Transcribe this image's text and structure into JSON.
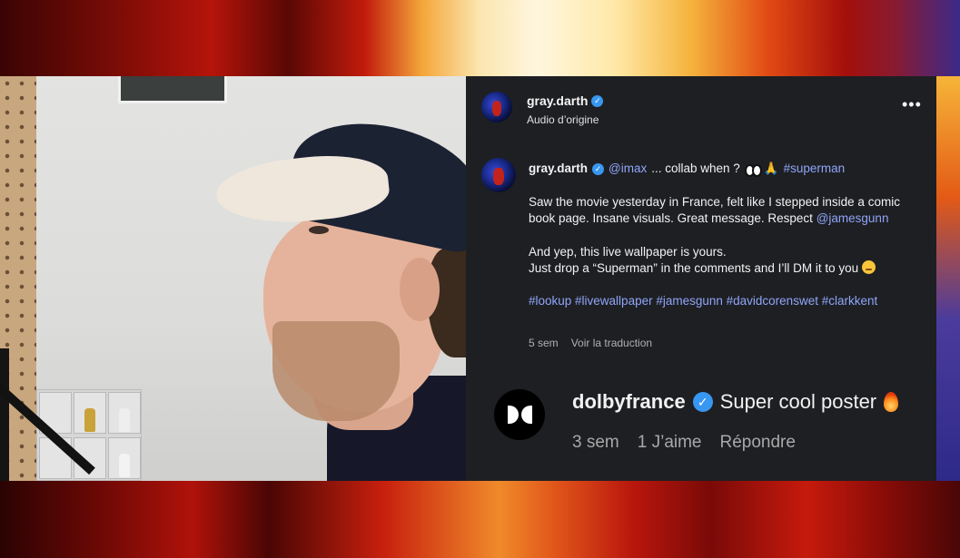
{
  "post": {
    "author": "gray.darth",
    "audio": "Audio d’origine",
    "more_label": "•••"
  },
  "caption": {
    "author": "gray.darth",
    "mention_imax": "@imax",
    "line1_text": "... collab when ?",
    "pray_emoji": "🙏",
    "hashtag_superman": "#superman",
    "para1": "Saw the movie yesterday in France, felt like I stepped inside a comic book page. Insane visuals. Great message. Respect",
    "mention_jamesgunn": "@jamesgunn",
    "para2_line1": "And yep, this live wallpaper is yours.",
    "para2_line2": "Just drop a “Superman” in the comments and I’ll DM it to you",
    "hashtags": "#lookup #livewallpaper #jamesgunn #davidcorenswet #clarkkent",
    "time_ago": "5 sem",
    "translate_label": "Voir la traduction"
  },
  "dolby_comment": {
    "author": "dolbyfrance",
    "text": "Super cool poster",
    "time_ago": "3 sem",
    "likes": "1 J’aime",
    "reply_label": "Répondre"
  },
  "colors": {
    "panel_bg": "#1e1f23",
    "link": "#8fa5f8",
    "verified": "#3897f0"
  },
  "icons": [
    "verified-badge-icon",
    "more-options-icon",
    "eyes-emoji-icon",
    "wink-emoji-icon",
    "fire-emoji-icon",
    "dolby-logo-icon"
  ]
}
